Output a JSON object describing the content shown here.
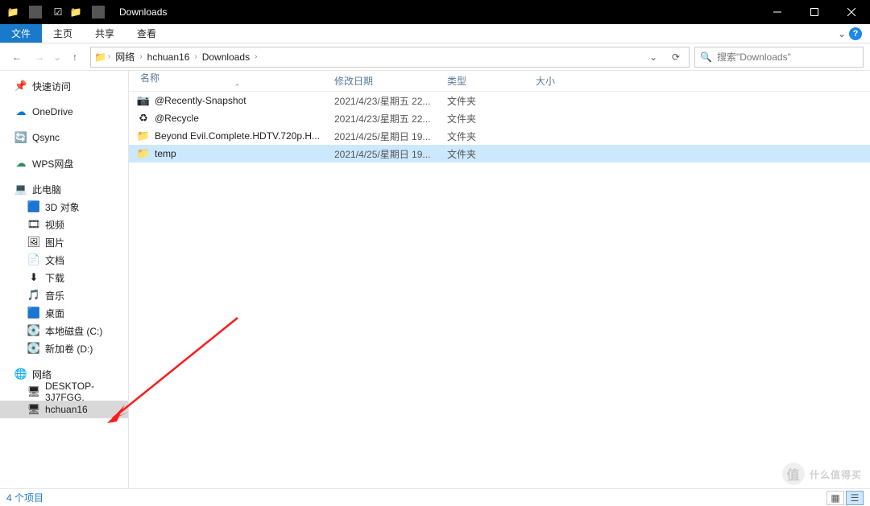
{
  "title": "Downloads",
  "ribbon": {
    "file": "文件",
    "home": "主页",
    "share": "共享",
    "view": "查看"
  },
  "breadcrumb": {
    "root": "网络",
    "user": "hchuan16",
    "folder": "Downloads"
  },
  "search": {
    "placeholder": "搜索\"Downloads\""
  },
  "columns": {
    "name": "名称",
    "date": "修改日期",
    "type": "类型",
    "size": "大小"
  },
  "nav": {
    "quick": "快速访问",
    "onedrive": "OneDrive",
    "qsync": "Qsync",
    "wps": "WPS网盘",
    "thispc": "此电脑",
    "obj3d": "3D 对象",
    "videos": "视频",
    "pictures": "图片",
    "docs": "文档",
    "downloads": "下载",
    "music": "音乐",
    "desktop": "桌面",
    "diskc": "本地磁盘 (C:)",
    "diskd": "新加卷 (D:)",
    "network": "网络",
    "pc1": "DESKTOP-3J7FGG.",
    "pc2": "hchuan16"
  },
  "rows": [
    {
      "icon": "snapshot",
      "name": "@Recently-Snapshot",
      "date": "2021/4/23/星期五 22...",
      "type": "文件夹",
      "size": "",
      "sel": false
    },
    {
      "icon": "recycle",
      "name": "@Recycle",
      "date": "2021/4/23/星期五 22...",
      "type": "文件夹",
      "size": "",
      "sel": false
    },
    {
      "icon": "folder",
      "name": "Beyond Evil.Complete.HDTV.720p.H...",
      "date": "2021/4/25/星期日 19...",
      "type": "文件夹",
      "size": "",
      "sel": false
    },
    {
      "icon": "folder",
      "name": "temp",
      "date": "2021/4/25/星期日 19...",
      "type": "文件夹",
      "size": "",
      "sel": true
    }
  ],
  "status": "4 个项目",
  "watermark": "什么值得买",
  "icons": {
    "quick": "📌",
    "onedrive": "☁",
    "qsync": "🔄",
    "wps": "☁",
    "thispc": "💻",
    "obj3d": "🟦",
    "videos": "🎞",
    "pictures": "🖼",
    "docs": "📄",
    "downloads": "⬇",
    "music": "🎵",
    "desktop": "🟦",
    "disk": "💽",
    "network": "🌐",
    "pc": "🖥",
    "folder": "📁",
    "snapshot": "📷",
    "recycle": "♻"
  }
}
